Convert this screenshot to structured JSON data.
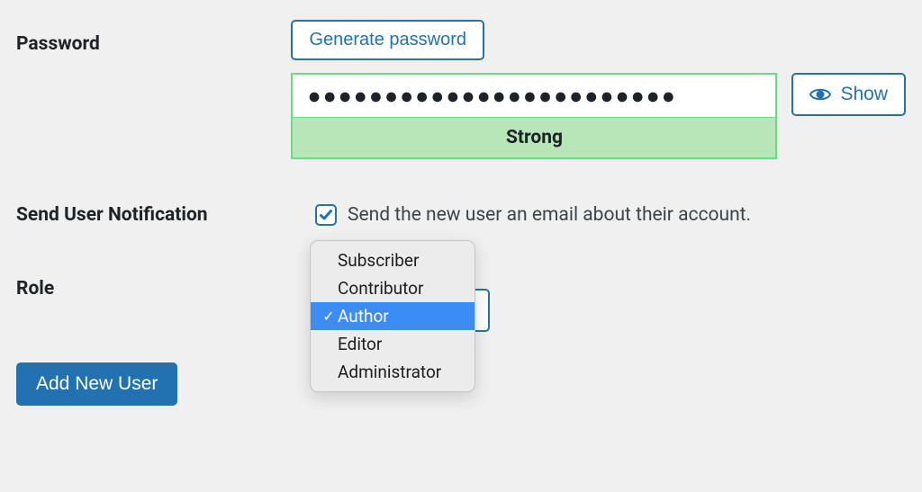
{
  "password": {
    "label": "Password",
    "generate_btn": "Generate password",
    "masked_value": "●●●●●●●●●●●●●●●●●●●●●●●●",
    "strength": "Strong",
    "show_btn": "Show"
  },
  "notification": {
    "label": "Send User Notification",
    "checked": true,
    "text": "Send the new user an email about their account."
  },
  "role": {
    "label": "Role",
    "options": [
      "Subscriber",
      "Contributor",
      "Author",
      "Editor",
      "Administrator"
    ],
    "selected": "Author"
  },
  "submit": {
    "label": "Add New User"
  }
}
